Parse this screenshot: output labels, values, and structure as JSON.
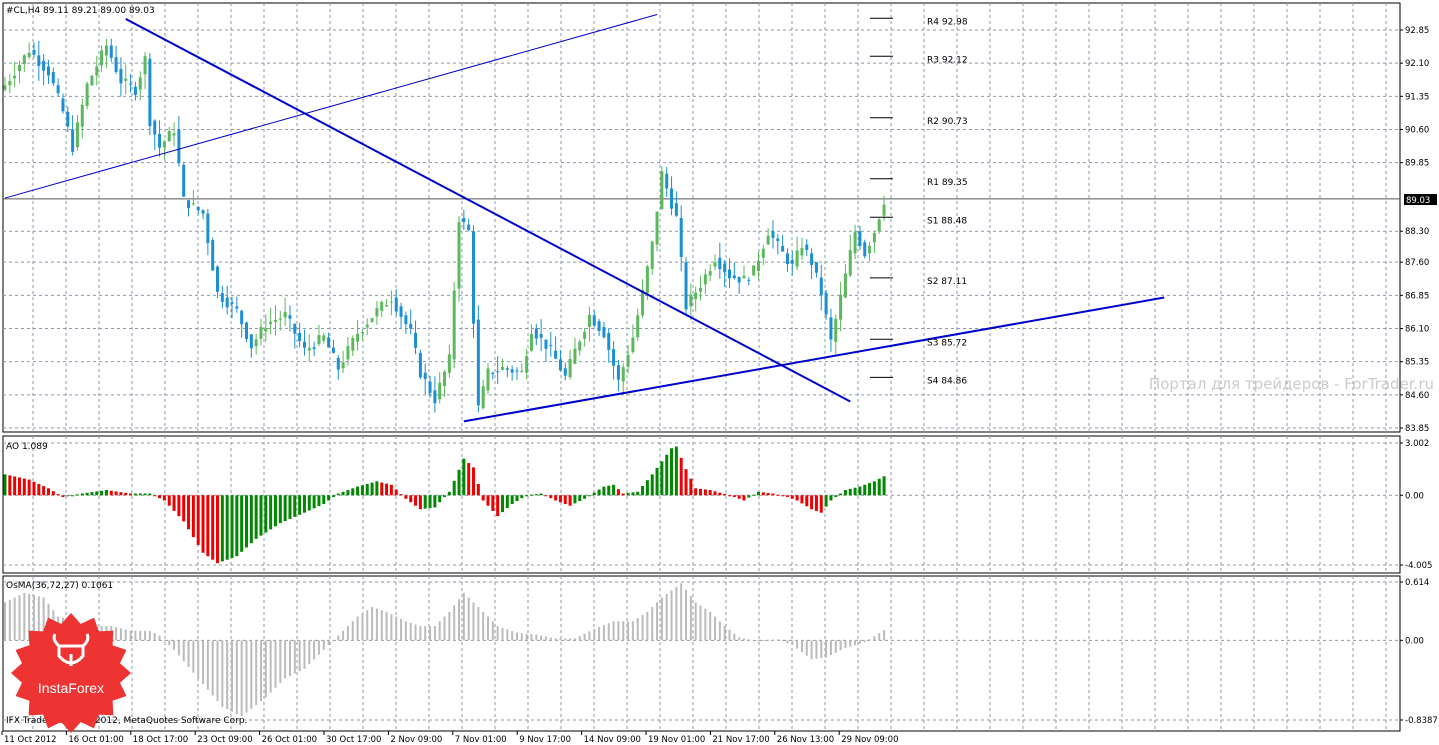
{
  "colors": {
    "bull": "#5cb85c",
    "bear": "#1a8fd1",
    "trendline": "#0000cc",
    "ao_up": "#008800",
    "ao_down": "#ee0000",
    "osma": "#bbbbbb",
    "grid": "#8a9aae",
    "pivot_tick": "#000000",
    "logo": "#ee3333"
  },
  "header": {
    "main_title": "#CL,H4  89.11 89.21 89.00 89.03",
    "current_price": "89.03"
  },
  "watermark": "Портал для трейдеров - ForTrader.ru",
  "copyright": "IFX Trader, © 2001-2012, MetaQuotes Software Corp.",
  "logo": {
    "label": "InstaForex",
    "icon": "bull-head-icon"
  },
  "chart_data": [
    {
      "type": "candlestick",
      "title": "#CL,H4  89.11 89.21 89.00 89.03",
      "ylim": [
        83.6,
        93.2
      ],
      "yticks": [
        "92.85",
        "92.10",
        "91.35",
        "90.60",
        "89.85",
        "88.30",
        "87.60",
        "86.85",
        "86.10",
        "85.35",
        "84.60",
        "83.85"
      ],
      "ytick_values": [
        92.85,
        92.1,
        91.35,
        90.6,
        89.85,
        88.3,
        87.6,
        86.85,
        86.1,
        85.35,
        84.6,
        83.85
      ],
      "current_price": 89.03,
      "grid": true,
      "pivots": [
        {
          "label": "R4 92.98",
          "value": 92.98
        },
        {
          "label": "R3 92.12",
          "value": 92.12
        },
        {
          "label": "R2 90.73",
          "value": 90.73
        },
        {
          "label": "R1 89.35",
          "value": 89.35
        },
        {
          "label": "S1 88.48",
          "value": 88.48
        },
        {
          "label": "S2 87.11",
          "value": 87.11
        },
        {
          "label": "S3 85.72",
          "value": 85.72
        },
        {
          "label": "S4 84.86",
          "value": 84.86
        }
      ],
      "anchors": [
        [
          0,
          91.6
        ],
        [
          5,
          92.4
        ],
        [
          9,
          91.9
        ],
        [
          12,
          91.0
        ],
        [
          14,
          90.2
        ],
        [
          17,
          91.6
        ],
        [
          21,
          92.5
        ],
        [
          24,
          91.7
        ],
        [
          27,
          91.5
        ],
        [
          29,
          92.2
        ],
        [
          30,
          90.8
        ],
        [
          32,
          90.2
        ],
        [
          35,
          90.6
        ],
        [
          37,
          89.0
        ],
        [
          41,
          88.7
        ],
        [
          44,
          86.9
        ],
        [
          48,
          86.5
        ],
        [
          51,
          85.7
        ],
        [
          54,
          86.2
        ],
        [
          58,
          86.4
        ],
        [
          62,
          85.6
        ],
        [
          66,
          85.9
        ],
        [
          69,
          85.2
        ],
        [
          73,
          86.0
        ],
        [
          77,
          86.5
        ],
        [
          80,
          86.8
        ],
        [
          84,
          86.0
        ],
        [
          86,
          85.1
        ],
        [
          89,
          84.5
        ],
        [
          92,
          85.4
        ],
        [
          94,
          88.6
        ],
        [
          96,
          88.3
        ],
        [
          98,
          84.3
        ],
        [
          100,
          85.1
        ],
        [
          103,
          85.2
        ],
        [
          107,
          85.1
        ],
        [
          109,
          86.1
        ],
        [
          113,
          85.6
        ],
        [
          116,
          85.0
        ],
        [
          118,
          85.6
        ],
        [
          121,
          86.4
        ],
        [
          124,
          86.0
        ],
        [
          127,
          84.9
        ],
        [
          130,
          85.9
        ],
        [
          132,
          86.9
        ],
        [
          134,
          88.0
        ],
        [
          136,
          89.6
        ],
        [
          139,
          88.6
        ],
        [
          141,
          86.6
        ],
        [
          144,
          87.1
        ],
        [
          147,
          87.7
        ],
        [
          150,
          87.3
        ],
        [
          153,
          87.2
        ],
        [
          155,
          87.4
        ],
        [
          158,
          88.3
        ],
        [
          161,
          87.8
        ],
        [
          163,
          87.5
        ],
        [
          165,
          88.0
        ],
        [
          167,
          87.6
        ],
        [
          169,
          86.9
        ],
        [
          171,
          85.8
        ],
        [
          173,
          86.8
        ],
        [
          176,
          88.3
        ],
        [
          178,
          87.8
        ],
        [
          180,
          88.3
        ],
        [
          182,
          89.0
        ]
      ],
      "trendlines": [
        {
          "name": "upper-channel",
          "from": [
            0,
            89.05
          ],
          "to": [
            135,
            93.2
          ],
          "width": 1
        },
        {
          "name": "descending",
          "from": [
            25,
            93.1
          ],
          "to": [
            175,
            84.45
          ],
          "width": 2
        },
        {
          "name": "ascending",
          "from": [
            95,
            84.0
          ],
          "to": [
            240,
            86.8
          ],
          "width": 2
        }
      ],
      "xticks": [
        "11 Oct 2012",
        "16 Oct 01:00",
        "18 Oct 17:00",
        "23 Oct 09:00",
        "26 Oct 01:00",
        "30 Oct 17:00",
        "2 Nov 09:00",
        "7 Nov 01:00",
        "9 Nov 17:00",
        "14 Nov 09:00",
        "19 Nov 01:00",
        "21 Nov 17:00",
        "26 Nov 13:00",
        "29 Nov 09:00"
      ]
    },
    {
      "type": "bar",
      "title": "AO 1.089",
      "ylim": [
        -4.005,
        3.002
      ],
      "yticks": [
        "3.002",
        "0.00",
        "-4.005"
      ],
      "ytick_values": [
        3.002,
        0,
        -4.005
      ],
      "current_value": 1.089,
      "anchors": [
        [
          0,
          1.2
        ],
        [
          5,
          0.9
        ],
        [
          9,
          0.4
        ],
        [
          12,
          -0.1
        ],
        [
          16,
          0.1
        ],
        [
          21,
          0.3
        ],
        [
          26,
          0.1
        ],
        [
          30,
          0.1
        ],
        [
          33,
          -0.3
        ],
        [
          37,
          -1.5
        ],
        [
          41,
          -3.3
        ],
        [
          44,
          -3.9
        ],
        [
          48,
          -3.5
        ],
        [
          52,
          -2.5
        ],
        [
          57,
          -1.6
        ],
        [
          62,
          -1.0
        ],
        [
          66,
          -0.5
        ],
        [
          69,
          0.1
        ],
        [
          73,
          0.5
        ],
        [
          77,
          0.8
        ],
        [
          80,
          0.6
        ],
        [
          83,
          -0.2
        ],
        [
          86,
          -0.8
        ],
        [
          89,
          -0.7
        ],
        [
          92,
          0.2
        ],
        [
          95,
          2.1
        ],
        [
          97,
          1.6
        ],
        [
          99,
          -0.3
        ],
        [
          102,
          -1.2
        ],
        [
          105,
          -0.5
        ],
        [
          108,
          0.0
        ],
        [
          111,
          0.1
        ],
        [
          114,
          -0.3
        ],
        [
          117,
          -0.6
        ],
        [
          120,
          -0.2
        ],
        [
          124,
          0.5
        ],
        [
          126,
          0.6
        ],
        [
          128,
          0.1
        ],
        [
          131,
          0.2
        ],
        [
          134,
          1.2
        ],
        [
          138,
          2.7
        ],
        [
          139,
          2.8
        ],
        [
          141,
          1.5
        ],
        [
          143,
          0.4
        ],
        [
          146,
          0.3
        ],
        [
          150,
          0.0
        ],
        [
          153,
          -0.3
        ],
        [
          156,
          0.2
        ],
        [
          159,
          0.1
        ],
        [
          162,
          -0.1
        ],
        [
          164,
          -0.3
        ],
        [
          167,
          -0.8
        ],
        [
          169,
          -1.0
        ],
        [
          171,
          -0.3
        ],
        [
          174,
          0.3
        ],
        [
          177,
          0.5
        ],
        [
          180,
          0.8
        ],
        [
          182,
          1.089
        ]
      ]
    },
    {
      "type": "bar",
      "title": "OsMA(36,72,27) 0.1061",
      "ylim": [
        -0.8387,
        0.614
      ],
      "yticks": [
        "0.614",
        "0.00",
        "-0.8387"
      ],
      "ytick_values": [
        0.614,
        0,
        -0.8387
      ],
      "current_value": 0.1061,
      "anchors": [
        [
          0,
          0.4
        ],
        [
          4,
          0.5
        ],
        [
          8,
          0.45
        ],
        [
          11,
          0.25
        ],
        [
          15,
          0.2
        ],
        [
          18,
          0.15
        ],
        [
          22,
          0.15
        ],
        [
          26,
          0.1
        ],
        [
          30,
          0.1
        ],
        [
          32,
          0.05
        ],
        [
          35,
          -0.1
        ],
        [
          40,
          -0.4
        ],
        [
          45,
          -0.7
        ],
        [
          49,
          -0.8
        ],
        [
          54,
          -0.6
        ],
        [
          58,
          -0.4
        ],
        [
          62,
          -0.3
        ],
        [
          66,
          -0.1
        ],
        [
          70,
          0.1
        ],
        [
          73,
          0.25
        ],
        [
          76,
          0.35
        ],
        [
          79,
          0.3
        ],
        [
          83,
          0.2
        ],
        [
          86,
          0.15
        ],
        [
          89,
          0.15
        ],
        [
          92,
          0.3
        ],
        [
          95,
          0.5
        ],
        [
          98,
          0.35
        ],
        [
          102,
          0.15
        ],
        [
          106,
          0.08
        ],
        [
          110,
          0.06
        ],
        [
          114,
          0.02
        ],
        [
          118,
          0.02
        ],
        [
          122,
          0.12
        ],
        [
          126,
          0.2
        ],
        [
          130,
          0.2
        ],
        [
          133,
          0.3
        ],
        [
          136,
          0.45
        ],
        [
          140,
          0.6
        ],
        [
          143,
          0.4
        ],
        [
          146,
          0.3
        ],
        [
          149,
          0.15
        ],
        [
          152,
          0.03
        ],
        [
          155,
          0.0
        ],
        [
          160,
          0.01
        ],
        [
          163,
          -0.05
        ],
        [
          167,
          -0.2
        ],
        [
          170,
          -0.18
        ],
        [
          174,
          -0.08
        ],
        [
          178,
          -0.02
        ],
        [
          182,
          0.1061
        ]
      ]
    }
  ]
}
